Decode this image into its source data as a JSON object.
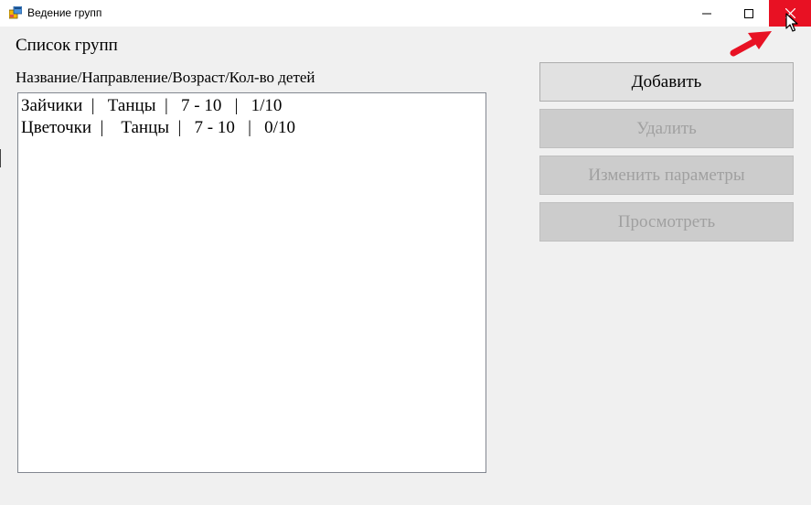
{
  "window": {
    "title": "Ведение групп",
    "icon": "winforms-app-icon",
    "controls": {
      "minimize": "—",
      "maximize": "☐",
      "close": "✕"
    },
    "accent": {
      "close_bg": "#e81123",
      "annotation_arrow": "#e81123"
    }
  },
  "main": {
    "heading": "Список групп",
    "column_header": "Название/Направление/Возраст/Кол-во детей",
    "groups": [
      "Зайчики  |   Танцы  |   7 - 10   |   1/10",
      "Цветочки  |    Танцы  |   7 - 10   |   0/10"
    ]
  },
  "actions": {
    "add": {
      "label": "Добавить",
      "enabled": true
    },
    "delete": {
      "label": "Удалить",
      "enabled": false
    },
    "edit": {
      "label": "Изменить параметры",
      "enabled": false
    },
    "view": {
      "label": "Просмотреть",
      "enabled": false
    }
  }
}
